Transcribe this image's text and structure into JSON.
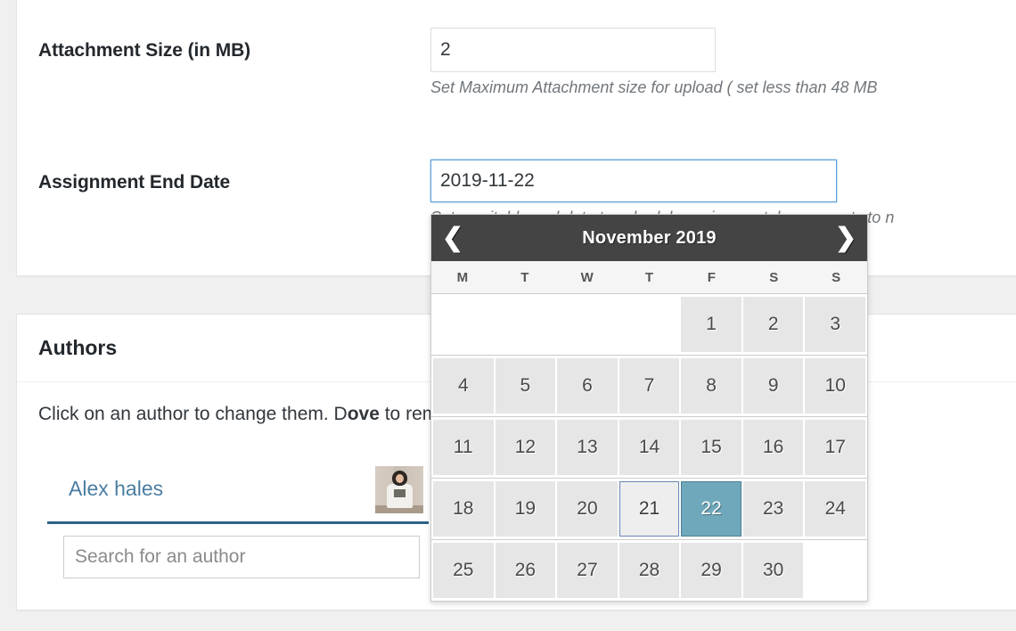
{
  "settings": {
    "attachment_size": {
      "label": "Attachment Size (in MB)",
      "value": "2",
      "help": "Set Maximum Attachment size for upload ( set less than 48 MB"
    },
    "assignment_end_date": {
      "label": "Assignment End Date",
      "value": "2019-11-22",
      "help": "Set a suitable end date to schedule assignment, leave empty to n"
    }
  },
  "authors": {
    "heading": "Authors",
    "instructions_before": "Click on an author to change them. D",
    "instructions_bold": "ove",
    "instructions_after": " to remove",
    "author_name": "Alex hales",
    "avatar_name": "author-avatar-photo",
    "search_placeholder": "Search for an author"
  },
  "datepicker": {
    "title": "November 2019",
    "prev_icon": "❮",
    "next_icon": "❯",
    "weekdays": [
      "M",
      "T",
      "W",
      "T",
      "F",
      "S",
      "S"
    ],
    "weeks": [
      [
        null,
        null,
        null,
        null,
        "1",
        "2",
        "3"
      ],
      [
        "4",
        "5",
        "6",
        "7",
        "8",
        "9",
        "10"
      ],
      [
        "11",
        "12",
        "13",
        "14",
        "15",
        "16",
        "17"
      ],
      [
        "18",
        "19",
        "20",
        "21",
        "22",
        "23",
        "24"
      ],
      [
        "25",
        "26",
        "27",
        "28",
        "29",
        "30",
        null
      ]
    ],
    "selected_day": "22",
    "highlighted_day": "21",
    "selected_color": "#6fa8bb",
    "header_color": "#444444"
  }
}
